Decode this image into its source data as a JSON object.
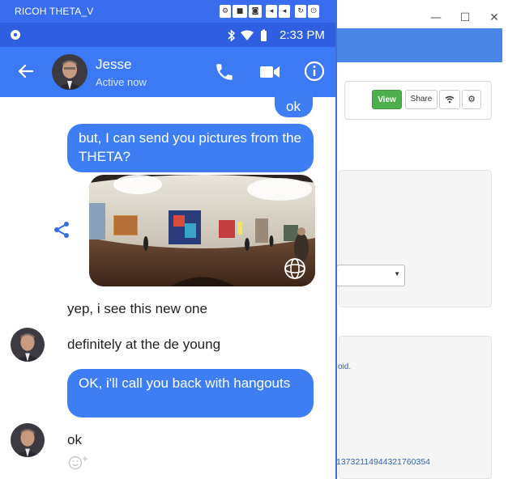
{
  "background_window": {
    "controls": {
      "minimize": "—",
      "maximize": "☐",
      "close": "✕"
    },
    "buttons": {
      "view": "View",
      "share": "Share"
    },
    "icons": {
      "wifi": "wifi-icon",
      "gear": "gear-icon"
    },
    "partial_text": "oid.",
    "device_id": "1373211494432176035​4"
  },
  "phone_window": {
    "title": "RICOH THETA_V",
    "title_buttons": [
      "gear-icon",
      "video-icon",
      "camera-icon",
      "volume-down-icon",
      "volume-up-icon",
      "rotate-icon",
      "power-icon"
    ],
    "status_bar": {
      "time": "2:33 PM",
      "icons": [
        "bluetooth-icon",
        "wifi-icon",
        "battery-icon"
      ]
    },
    "header": {
      "name": "Jesse",
      "status": "Active now"
    },
    "messages": {
      "out_ok": "ok",
      "out_pictures": "but, I can send you pictures from the THETA?",
      "in_yep": "yep, i see this new one",
      "in_deyoung": "definitely at the de young",
      "out_hangouts": "OK, i'll call you back with hangouts",
      "in_ok": "ok"
    },
    "colors": {
      "titlebar": "#3a6cf0",
      "header": "#3b79f5",
      "bubble": "#3e7ef5"
    }
  }
}
